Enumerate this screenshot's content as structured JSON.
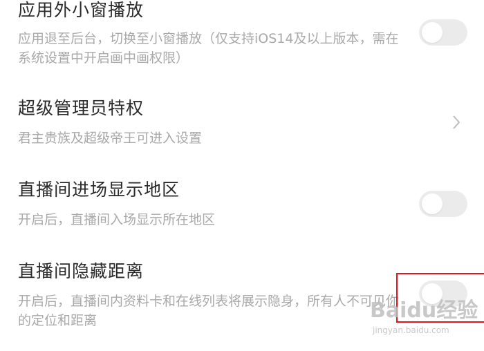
{
  "settings": [
    {
      "title": "应用外小窗播放",
      "description": "应用退至后台，切换至小窗播放（仅支持iOS14及以上版本，需在系统设置中开启画中画权限）",
      "control": "toggle",
      "enabled": false
    },
    {
      "title": "超级管理员特权",
      "description": "君主贵族及超级帝王可进入设置",
      "control": "chevron-right-icon"
    },
    {
      "title": "直播间进场显示地区",
      "description": "开启后，直播间入场显示所在地区",
      "control": "toggle",
      "enabled": false
    },
    {
      "title": "直播间隐藏距离",
      "description": "开启后，直播间内资料卡和在线列表将展示隐身，所有人不可见你的定位和距离",
      "control": "toggle",
      "enabled": false
    }
  ],
  "colors": {
    "title": "#2a2a2a",
    "description": "#a9a9a9",
    "toggle_off": "#ebebeb",
    "highlight_box": "#e3161f"
  },
  "watermark": {
    "brand": "Baidu经验",
    "url": "jingyan.baidu.com"
  }
}
